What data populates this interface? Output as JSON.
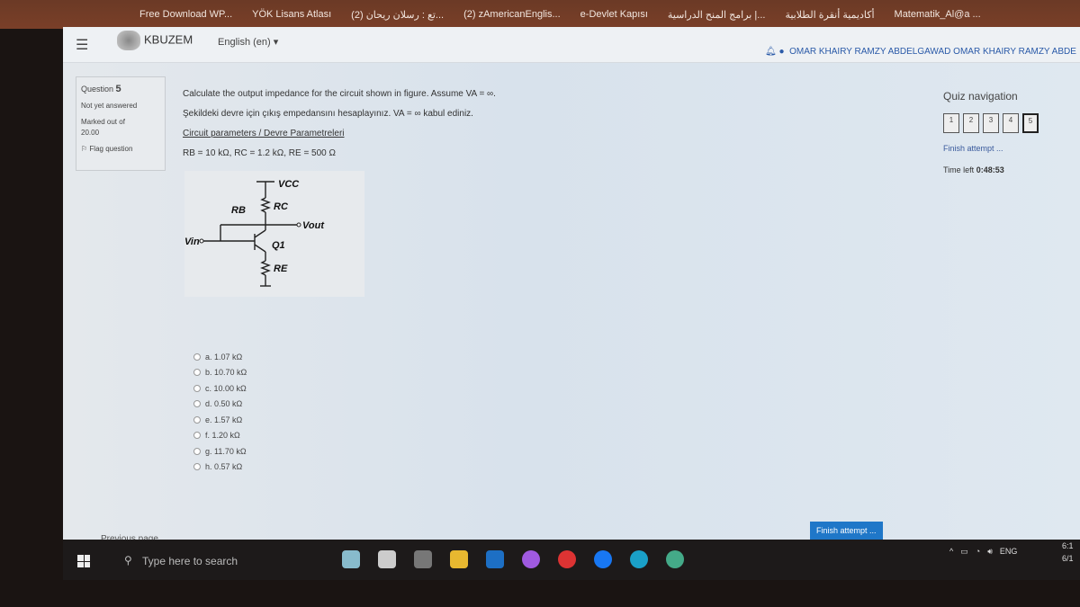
{
  "bookmarks": [
    "Free Download WP...",
    "YÖK Lisans Atlası",
    "تع : رسلان ريحان (2)...",
    "(2) zAmericanEnglis...",
    "e-Devlet Kapısı",
    "برامج المنح الدراسية |...",
    "أكاديمية أنقرة الطلابية",
    "Matematik_Al@a ..."
  ],
  "header": {
    "site": "KBUZEM",
    "language": "English (en)",
    "user": "OMAR KHAIRY RAMZY ABDELGAWAD OMAR KHAIRY RAMZY ABDE"
  },
  "info": {
    "question_label": "Question",
    "question_number": "5",
    "status": "Not yet answered",
    "marked": "Marked out of",
    "mark": "20.00",
    "flag": "Flag question"
  },
  "question": {
    "text_en": "Calculate the output impedance for the circuit shown in figure. Assume VA = ∞.",
    "text_tr": "Şekildeki devre için çıkış empedansını hesaplayınız. VA = ∞ kabul ediniz.",
    "params_title": "Circuit parameters / Devre Parametreleri",
    "params": "RB = 10 kΩ, RC = 1.2 kΩ, RE = 500 Ω"
  },
  "circuit": {
    "vcc": "VCC",
    "rb": "RB",
    "rc": "RC",
    "vout": "Vout",
    "vin": "Vin",
    "q": "Q1",
    "re": "RE"
  },
  "options": [
    "a. 1.07 kΩ",
    "b. 10.70 kΩ",
    "c. 10.00 kΩ",
    "d. 0.50 kΩ",
    "e. 1.57 kΩ",
    "f. 1.20 kΩ",
    "g. 11.70 kΩ",
    "h. 0.57 kΩ"
  ],
  "nav": {
    "title": "Quiz navigation",
    "questions": [
      "1",
      "2",
      "3",
      "4",
      "5"
    ],
    "current": "5",
    "finish": "Finish attempt ...",
    "time_label": "Time left",
    "time": "0:48:53"
  },
  "footer": {
    "previous": "Previous page",
    "finish_button": "Finish attempt ..."
  },
  "taskbar": {
    "search": "Type here to search",
    "lang": "ENG",
    "time": "6:1",
    "date": "6/1"
  }
}
